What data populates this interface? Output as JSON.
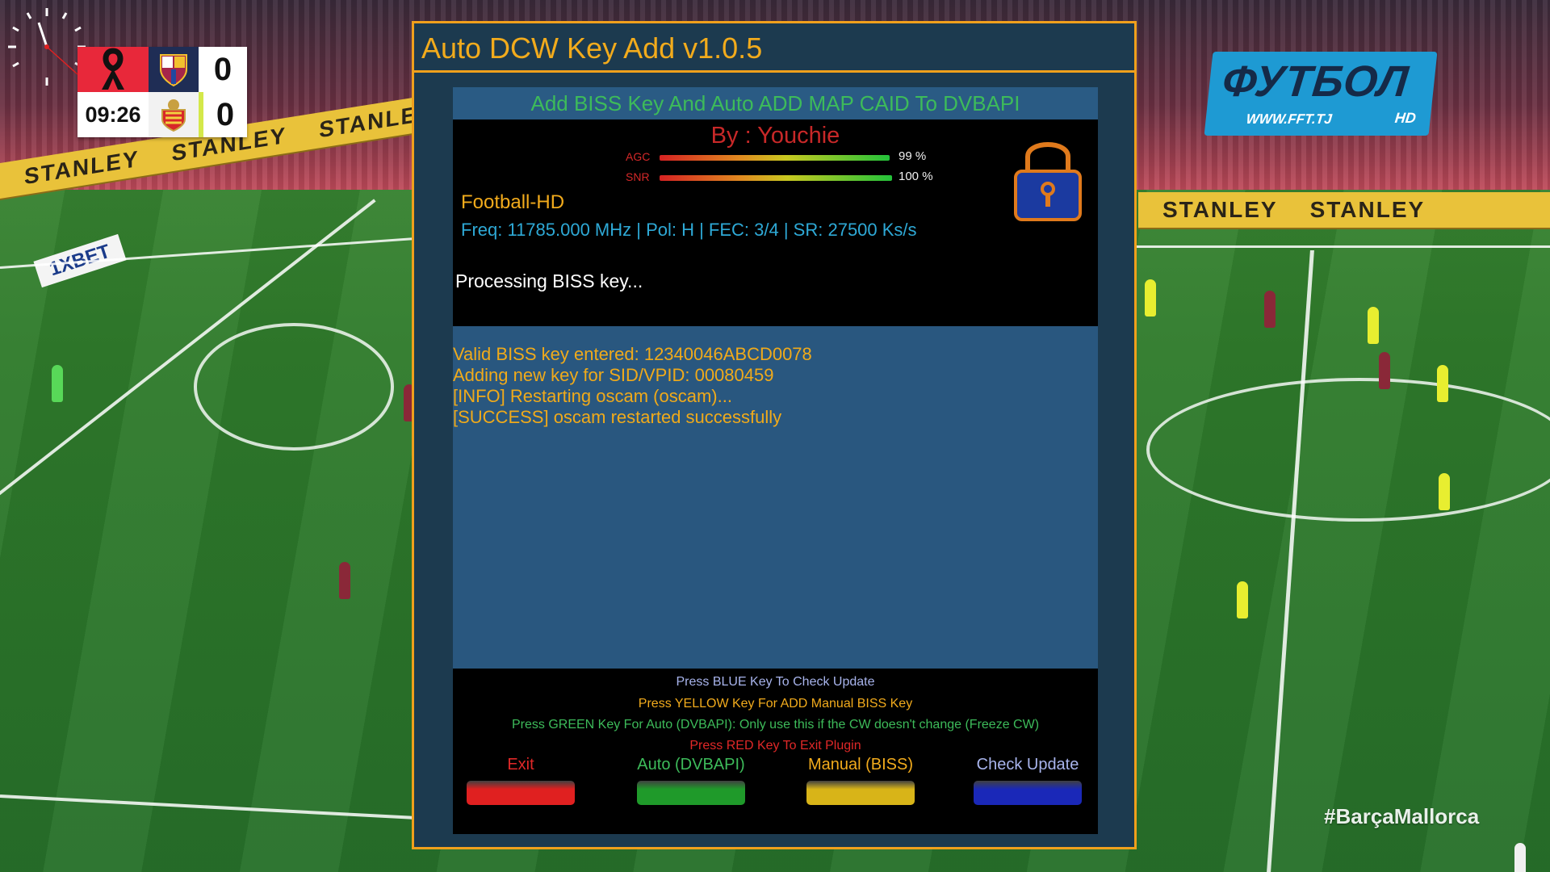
{
  "background": {
    "adboard_text": "STANLEY",
    "sponsor_text": "1XBET",
    "hashtag": "#BarçaMallorca"
  },
  "scoreboard": {
    "time": "09:26",
    "home_score": "0",
    "away_score": "0"
  },
  "channel_logo": {
    "name": "ФУТБОЛ",
    "url": "WWW.FFT.TJ",
    "badge": "HD"
  },
  "plugin": {
    "title": "Auto DCW Key Add v1.0.5",
    "subtitle": "Add BISS Key And Auto ADD MAP CAID To DVBAPI",
    "author": "By : Youchie",
    "signal": {
      "agc_label": "AGC",
      "agc_value": "99 %",
      "agc_level": 0.99,
      "snr_label": "SNR",
      "snr_value": "100 %",
      "snr_level": 1.0
    },
    "channel": "Football-HD",
    "frequency_line": "Freq: 11785.000 MHz | Pol: H | FEC: 3/4 | SR: 27500 Ks/s",
    "status": "Processing BISS key...",
    "lock_icon": "lock-icon",
    "log": [
      "Valid BISS key entered: 12340046ABCD0078",
      "Adding new key for SID/VPID: 00080459",
      "[INFO] Restarting oscam (oscam)...",
      "[SUCCESS] oscam restarted successfully"
    ],
    "help": {
      "blue": "Press BLUE Key To Check Update",
      "yellow": "Press YELLOW Key For ADD Manual BISS Key",
      "green": "Press GREEN Key For Auto (DVBAPI): Only use this if the CW doesn't change (Freeze CW)",
      "red": "Press RED Key To Exit Plugin"
    },
    "buttons": {
      "red": {
        "label": "Exit",
        "color": "#e02020"
      },
      "green": {
        "label": "Auto (DVBAPI)",
        "color": "#1f9a2a"
      },
      "yellow": {
        "label": "Manual (BISS)",
        "color": "#d8b418"
      },
      "blue": {
        "label": "Check Update",
        "color": "#1a28b8"
      }
    },
    "colors": {
      "frame": "#f0a01c",
      "title": "#f2ab1c",
      "subtitle": "#3dbb5a",
      "author": "#c82828",
      "log_text": "#f0aa1a",
      "help_blue": "#a8b4ec",
      "help_yellow": "#f2ab1c",
      "help_green": "#3dbb5a",
      "help_red": "#e02828"
    }
  }
}
